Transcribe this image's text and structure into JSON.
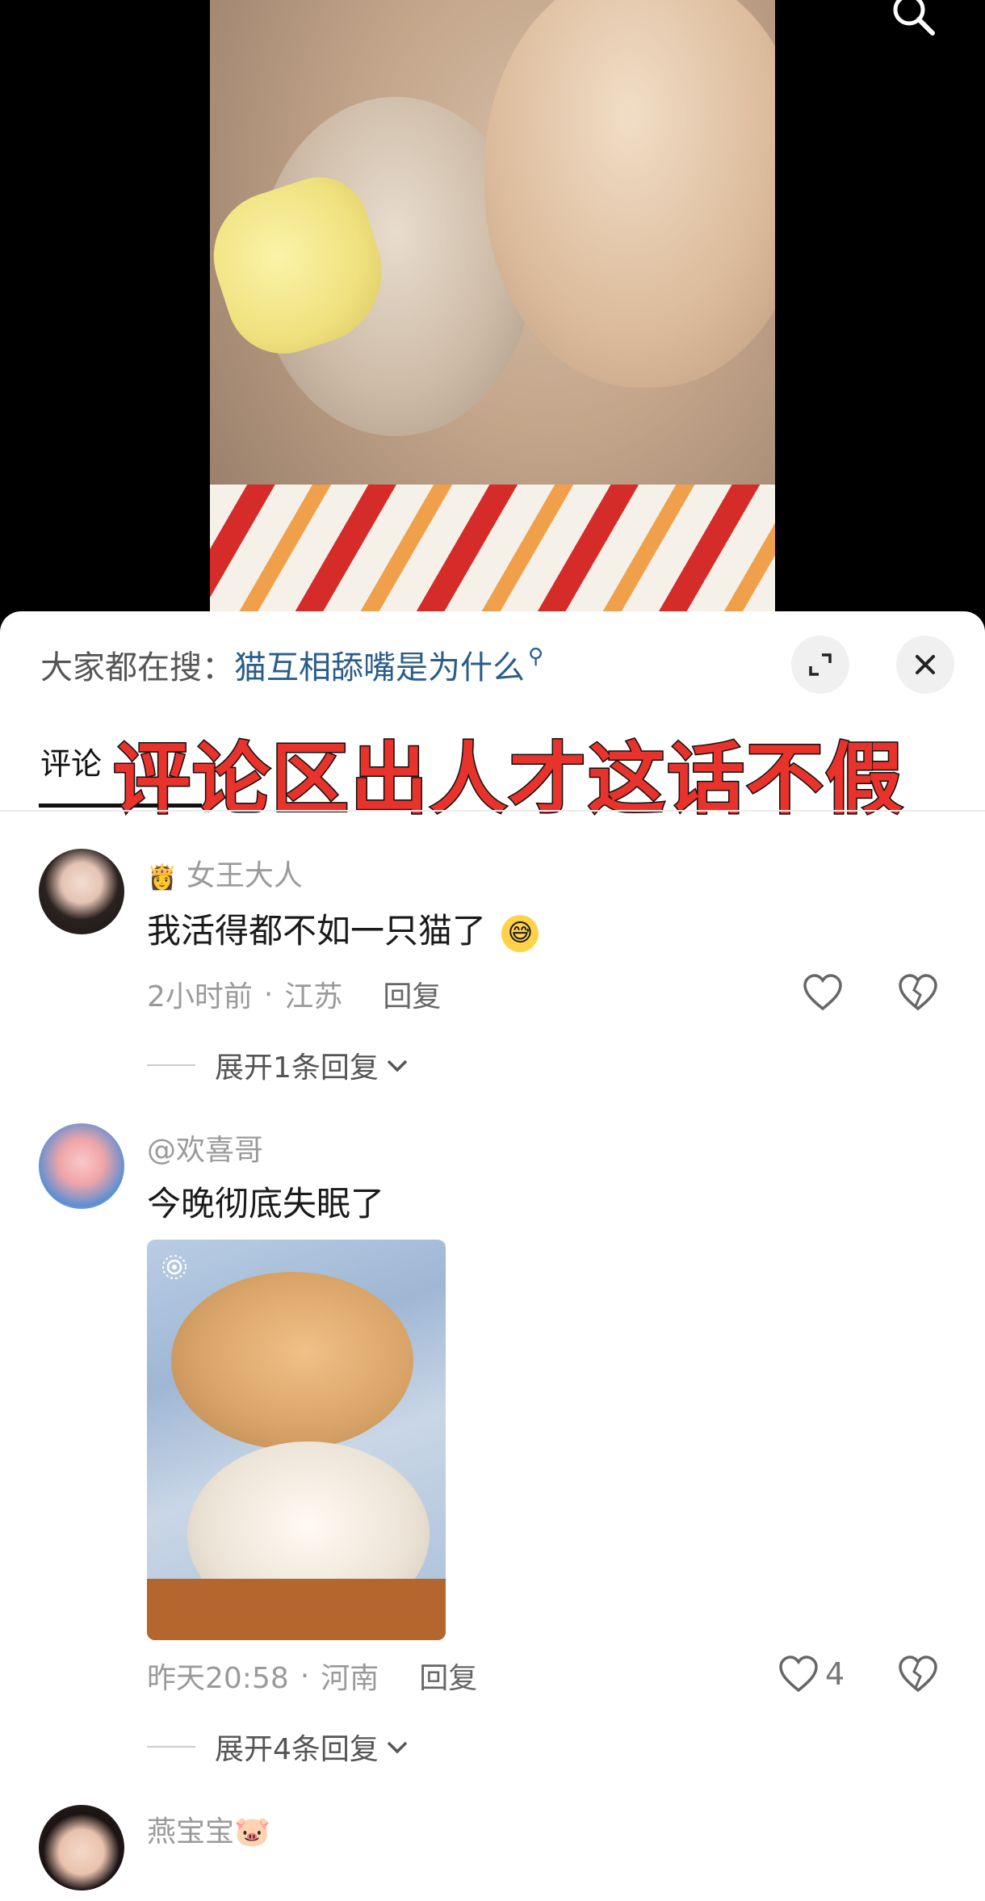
{
  "trending": {
    "prefix": "大家都在搜：",
    "query": "猫互相舔嘴是为什么"
  },
  "tabs": {
    "comments_label": "评论"
  },
  "overlay_title": "评论区出人才这话不假",
  "comments": [
    {
      "username": "女王大人",
      "text": "我活得都不如一只猫了",
      "emoji": "😅",
      "time": "2小时前",
      "location": "江苏",
      "reply_label": "回复",
      "expand_label": "展开1条回复",
      "likes": ""
    },
    {
      "username": "@欢喜哥",
      "text": "今晚彻底失眠了",
      "time": "昨天20:58",
      "location": "河南",
      "reply_label": "回复",
      "expand_label": "展开4条回复",
      "likes": "4"
    },
    {
      "username": "燕宝宝🐷"
    }
  ],
  "colors": {
    "link": "#2b5d8a",
    "accent_red": "#e7332b"
  }
}
